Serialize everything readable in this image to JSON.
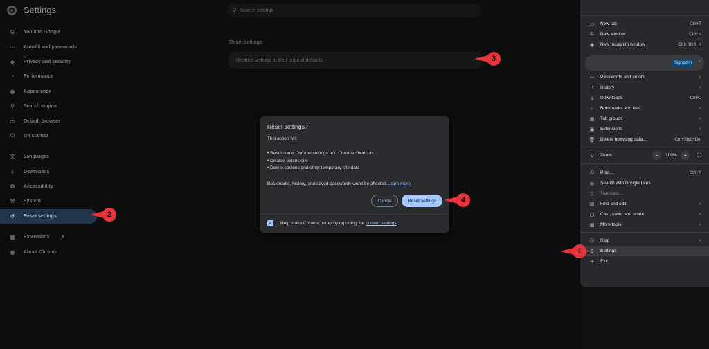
{
  "app": {
    "title": "Settings"
  },
  "search": {
    "placeholder": "Search settings"
  },
  "nav": {
    "items": [
      {
        "label": "You and Google",
        "icon": "google-icon"
      },
      {
        "label": "Autofill and passwords",
        "icon": "key-icon"
      },
      {
        "label": "Privacy and security",
        "icon": "shield-icon"
      },
      {
        "label": "Performance",
        "icon": "speedometer-icon"
      },
      {
        "label": "Appearance",
        "icon": "palette-icon"
      },
      {
        "label": "Search engine",
        "icon": "search-icon"
      },
      {
        "label": "Default browser",
        "icon": "browser-icon"
      },
      {
        "label": "On startup",
        "icon": "power-icon"
      },
      {
        "label": "Languages",
        "icon": "translate-icon"
      },
      {
        "label": "Downloads",
        "icon": "download-icon"
      },
      {
        "label": "Accessibility",
        "icon": "accessibility-icon"
      },
      {
        "label": "System",
        "icon": "wrench-icon"
      },
      {
        "label": "Reset settings",
        "icon": "reset-icon"
      },
      {
        "label": "Extensions",
        "icon": "puzzle-icon"
      },
      {
        "label": "About Chrome",
        "icon": "chrome-icon"
      }
    ]
  },
  "main": {
    "section_title": "Reset settings",
    "card_label": "Restore settings to their original defaults"
  },
  "dialog": {
    "title": "Reset settings?",
    "intro": "This action will:",
    "bullets": [
      "• Reset some Chrome settings and Chrome shortcuts",
      "• Disable extensions",
      "• Delete cookies and other temporary site data"
    ],
    "note": "Bookmarks, history, and saved passwords won't be affected.",
    "learn_more": "Learn more",
    "cancel_label": "Cancel",
    "reset_label": "Reset settings",
    "footer_text": "Help make Chrome better by reporting the ",
    "footer_link": "current settings"
  },
  "menu": {
    "new_tab": {
      "label": "New tab",
      "shortcut": "Ctrl+T"
    },
    "new_window": {
      "label": "New window",
      "shortcut": "Ctrl+N"
    },
    "incognito": {
      "label": "New Incognito window",
      "shortcut": "Ctrl+Shift+N"
    },
    "signed_in": "Signed in",
    "passwords": {
      "label": "Passwords and autofill"
    },
    "history": {
      "label": "History"
    },
    "downloads": {
      "label": "Downloads",
      "shortcut": "Ctrl+J"
    },
    "bookmarks": {
      "label": "Bookmarks and lists"
    },
    "tab_groups": {
      "label": "Tab groups"
    },
    "extensions": {
      "label": "Extensions"
    },
    "delete_data": {
      "label": "Delete browsing data...",
      "shortcut": "Ctrl+Shift+Del"
    },
    "zoom": {
      "label": "Zoom",
      "value": "100%",
      "minus": "−",
      "plus": "+"
    },
    "print": {
      "label": "Print...",
      "shortcut": "Ctrl+P"
    },
    "lens": {
      "label": "Search with Google Lens"
    },
    "translate": {
      "label": "Translate..."
    },
    "find_edit": {
      "label": "Find and edit"
    },
    "cast": {
      "label": "Cast, save, and share"
    },
    "more_tools": {
      "label": "More tools"
    },
    "help": {
      "label": "Help"
    },
    "settings": {
      "label": "Settings"
    },
    "exit": {
      "label": "Exit"
    }
  },
  "callouts": [
    "1",
    "2",
    "3",
    "4"
  ],
  "colors": {
    "accent": "#a8c7fa",
    "callout": "#e8333a",
    "nav_active": "#22344a"
  }
}
